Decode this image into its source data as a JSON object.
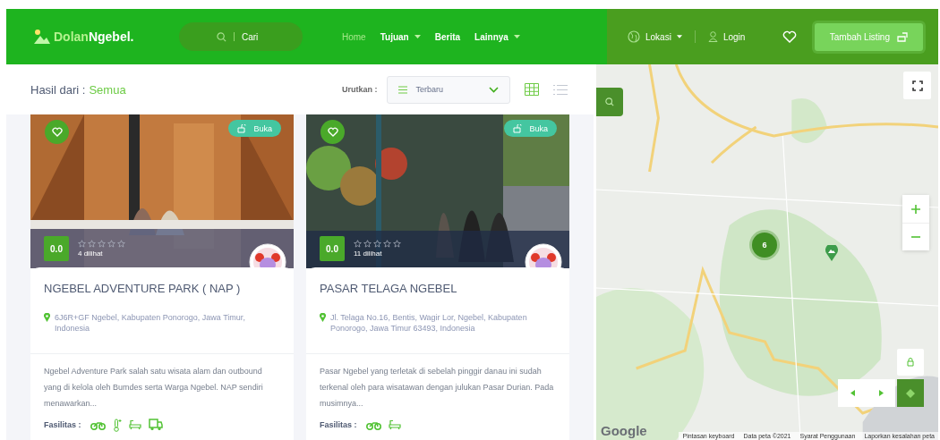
{
  "header": {
    "brand": {
      "first": "Dolan",
      "second": "Ngebel."
    },
    "search": {
      "placeholder": "Cari"
    },
    "nav": [
      {
        "label": "Home",
        "selected": true,
        "dropdown": false
      },
      {
        "label": "Tujuan",
        "selected": false,
        "dropdown": true
      },
      {
        "label": "Berita",
        "selected": false,
        "dropdown": false
      },
      {
        "label": "Lainnya",
        "selected": false,
        "dropdown": true
      }
    ],
    "location": "Lokasi",
    "login": "Login",
    "add_button": "Tambah Listing"
  },
  "results": {
    "prefix": "Hasil dari :",
    "filter": "Semua",
    "sort_label": "Urutkan :",
    "sort_value": "Terbaru",
    "views": [
      {
        "kind": "grid",
        "selected": true
      },
      {
        "kind": "list",
        "selected": false
      }
    ]
  },
  "listings": [
    {
      "status": "Buka",
      "rating": "0.0",
      "stars": 0,
      "views": "4 dilihat",
      "title": "NGEBEL ADVENTURE PARK ( NAP )",
      "address": "6J6R+GF Ngebel, Kabupaten Ponorogo, Jawa Timur, Indonesia",
      "description": "Ngebel Adventure Park salah satu wisata alam dan outbound yang di kelola oleh Bumdes serta Warga Ngebel. NAP sendiri menawarkan...",
      "facilities_label": "Fasilitas :",
      "facilities": [
        {
          "kind": "motorbike"
        },
        {
          "kind": "thermometer"
        },
        {
          "kind": "bathtub"
        },
        {
          "kind": "truck"
        }
      ]
    },
    {
      "status": "Buka",
      "rating": "0.0",
      "stars": 0,
      "views": "11 dilihat",
      "title": "PASAR TELAGA NGEBEL",
      "address": "Jl. Telaga No.16, Bentis, Wagir Lor, Ngebel, Kabupaten Ponorogo, Jawa Timur 63493, Indonesia",
      "description": "Pasar Ngebel yang terletak di sebelah pinggir danau ini sudah terkenal oleh para wisatawan dengan julukan Pasar Durian. Pada musimnya...",
      "facilities_label": "Fasilitas :",
      "facilities": [
        {
          "kind": "motorbike"
        },
        {
          "kind": "bathtub"
        }
      ]
    }
  ],
  "map": {
    "cluster": "6",
    "logo": "Google",
    "attribution": [
      "Pintasan keyboard",
      "Data peta ©2021",
      "Syarat Penggunaan",
      "Laporkan kesalahan peta"
    ]
  }
}
